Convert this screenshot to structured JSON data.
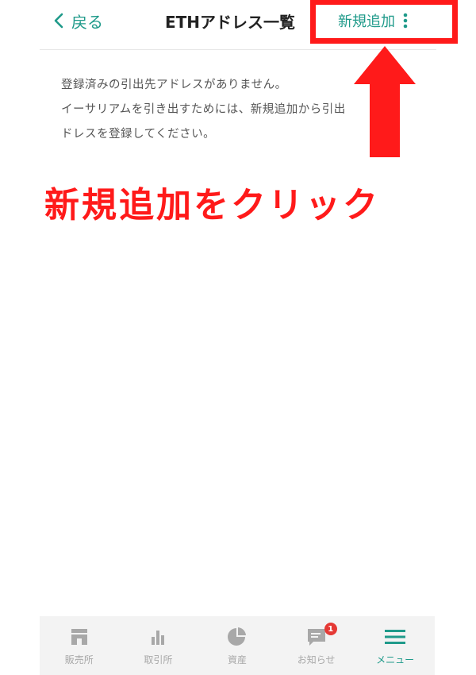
{
  "header": {
    "back_label": "戻る",
    "title": "ETHアドレス一覧",
    "add_label": "新規追加"
  },
  "message": {
    "lines": [
      "登録済みの引出先アドレスがありません。",
      "イーサリアムを引き出すためには、新規追加から引出",
      "ドレスを登録してください。"
    ]
  },
  "annotation": {
    "instruction": "新規追加をクリック",
    "color": "#ff1a1a"
  },
  "bottom_nav": {
    "items": [
      {
        "label": "販売所",
        "icon": "store-icon"
      },
      {
        "label": "取引所",
        "icon": "bar-chart-icon"
      },
      {
        "label": "資産",
        "icon": "pie-chart-icon"
      },
      {
        "label": "お知らせ",
        "icon": "chat-icon",
        "badge": "1"
      },
      {
        "label": "メニュー",
        "icon": "hamburger-icon",
        "active": true
      }
    ]
  },
  "colors": {
    "accent": "#1f9a8a",
    "inactive": "#a8a8a8",
    "badge": "#e53935"
  }
}
